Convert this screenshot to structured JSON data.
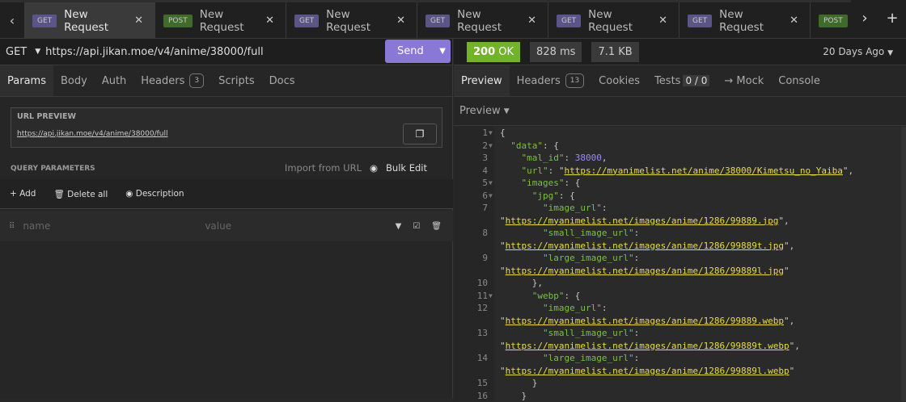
{
  "tabs": [
    {
      "method": "GET",
      "label": "New Request",
      "active": true
    },
    {
      "method": "POST",
      "label": "New Request"
    },
    {
      "method": "GET",
      "label": "New Request"
    },
    {
      "method": "GET",
      "label": "New Request"
    },
    {
      "method": "GET",
      "label": "New Request"
    },
    {
      "method": "GET",
      "label": "New Request"
    },
    {
      "method": "POST",
      "label": ""
    }
  ],
  "colors": {
    "get": "#5b5487",
    "post": "#3e6a2a",
    "send": "#8a78d6",
    "ok": "#73b22b"
  },
  "request": {
    "method": "GET",
    "url": "https://api.jikan.moe/v4/anime/38000/full",
    "send_label": "Send"
  },
  "request_tabs": [
    {
      "label": "Params",
      "active": true
    },
    {
      "label": "Body"
    },
    {
      "label": "Auth"
    },
    {
      "label": "Headers",
      "count": "3"
    },
    {
      "label": "Scripts"
    },
    {
      "label": "Docs"
    }
  ],
  "url_preview": {
    "title": "URL PREVIEW",
    "url": "https://api.jikan.moe/v4/anime/38000/full"
  },
  "query": {
    "title": "QUERY PARAMETERS",
    "import": "Import from URL",
    "bulk": "Bulk Edit",
    "add": "Add",
    "delete_all": "Delete all",
    "description": "Description",
    "name_placeholder": "name",
    "value_placeholder": "value"
  },
  "response": {
    "status_code": "200",
    "status_text": "OK",
    "time": "828 ms",
    "size": "7.1 KB",
    "ago": "20 Days Ago"
  },
  "response_tabs": [
    {
      "label": "Preview",
      "active": true
    },
    {
      "label": "Headers",
      "count": "13"
    },
    {
      "label": "Cookies"
    },
    {
      "label": "Tests",
      "count": "0 / 0"
    },
    {
      "label": "→ Mock"
    },
    {
      "label": "Console"
    }
  ],
  "preview_mode": "Preview",
  "code": [
    {
      "n": "1",
      "fold": true,
      "t": [
        [
          "p",
          "{"
        ]
      ]
    },
    {
      "n": "2",
      "fold": true,
      "t": [
        [
          "p",
          "  "
        ],
        [
          "k",
          "\"data\""
        ],
        [
          "p",
          ": {"
        ]
      ]
    },
    {
      "n": "3",
      "t": [
        [
          "p",
          "    "
        ],
        [
          "k",
          "\"mal_id\""
        ],
        [
          "p",
          ": "
        ],
        [
          "n",
          "38000"
        ],
        [
          "p",
          ","
        ]
      ]
    },
    {
      "n": "4",
      "t": [
        [
          "p",
          "    "
        ],
        [
          "k",
          "\"url\""
        ],
        [
          "p",
          ": \""
        ],
        [
          "u",
          "https://myanimelist.net/anime/38000/Kimetsu_no_Yaiba"
        ],
        [
          "p",
          "\","
        ]
      ]
    },
    {
      "n": "5",
      "fold": true,
      "t": [
        [
          "p",
          "    "
        ],
        [
          "k",
          "\"images\""
        ],
        [
          "p",
          ": {"
        ]
      ]
    },
    {
      "n": "6",
      "fold": true,
      "t": [
        [
          "p",
          "      "
        ],
        [
          "k",
          "\"jpg\""
        ],
        [
          "p",
          ": {"
        ]
      ]
    },
    {
      "n": "7",
      "t": [
        [
          "p",
          "        "
        ],
        [
          "k",
          "\"image_url\""
        ],
        [
          "p",
          ":"
        ]
      ]
    },
    {
      "n": "",
      "t": [
        [
          "p",
          "\""
        ],
        [
          "u",
          "https://myanimelist.net/images/anime/1286/99889.jpg"
        ],
        [
          "p",
          "\","
        ]
      ]
    },
    {
      "n": "8",
      "t": [
        [
          "p",
          "        "
        ],
        [
          "k",
          "\"small_image_url\""
        ],
        [
          "p",
          ":"
        ]
      ]
    },
    {
      "n": "",
      "t": [
        [
          "p",
          "\""
        ],
        [
          "u",
          "https://myanimelist.net/images/anime/1286/99889t.jpg"
        ],
        [
          "p",
          "\","
        ]
      ]
    },
    {
      "n": "9",
      "t": [
        [
          "p",
          "        "
        ],
        [
          "k",
          "\"large_image_url\""
        ],
        [
          "p",
          ":"
        ]
      ]
    },
    {
      "n": "",
      "t": [
        [
          "p",
          "\""
        ],
        [
          "u",
          "https://myanimelist.net/images/anime/1286/99889l.jpg"
        ],
        [
          "p",
          "\""
        ]
      ]
    },
    {
      "n": "10",
      "t": [
        [
          "p",
          "      },"
        ]
      ]
    },
    {
      "n": "11",
      "fold": true,
      "t": [
        [
          "p",
          "      "
        ],
        [
          "k",
          "\"webp\""
        ],
        [
          "p",
          ": {"
        ]
      ]
    },
    {
      "n": "12",
      "t": [
        [
          "p",
          "        "
        ],
        [
          "k",
          "\"image_url\""
        ],
        [
          "p",
          ":"
        ]
      ]
    },
    {
      "n": "",
      "t": [
        [
          "p",
          "\""
        ],
        [
          "u",
          "https://myanimelist.net/images/anime/1286/99889.webp"
        ],
        [
          "p",
          "\","
        ]
      ]
    },
    {
      "n": "13",
      "t": [
        [
          "p",
          "        "
        ],
        [
          "k",
          "\"small_image_url\""
        ],
        [
          "p",
          ":"
        ]
      ]
    },
    {
      "n": "",
      "t": [
        [
          "p",
          "\""
        ],
        [
          "u",
          "https://myanimelist.net/images/anime/1286/99889t.webp"
        ],
        [
          "p",
          "\","
        ]
      ]
    },
    {
      "n": "14",
      "t": [
        [
          "p",
          "        "
        ],
        [
          "k",
          "\"large_image_url\""
        ],
        [
          "p",
          ":"
        ]
      ]
    },
    {
      "n": "",
      "t": [
        [
          "p",
          "\""
        ],
        [
          "u",
          "https://myanimelist.net/images/anime/1286/99889l.webp"
        ],
        [
          "p",
          "\""
        ]
      ]
    },
    {
      "n": "15",
      "t": [
        [
          "p",
          "      }"
        ]
      ]
    },
    {
      "n": "16",
      "t": [
        [
          "p",
          "    }"
        ]
      ]
    }
  ]
}
